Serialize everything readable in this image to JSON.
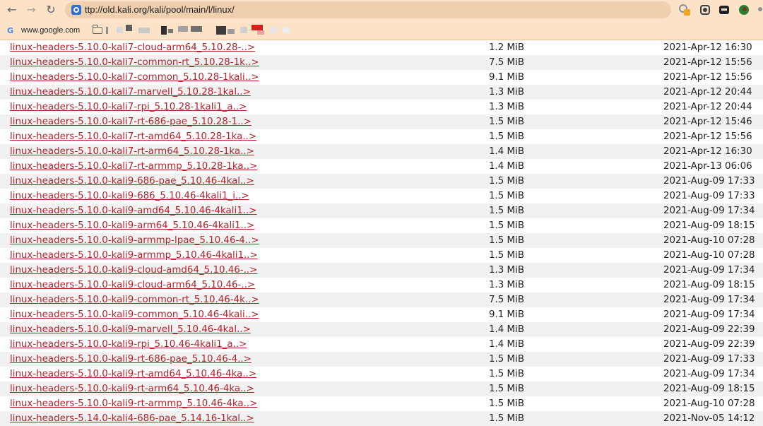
{
  "browser": {
    "back_icon": "back-arrow-icon",
    "forward_icon": "forward-arrow-icon",
    "reload_icon": "reload-icon",
    "url": "ttp://old.kali.org/kali/pool/main/l/linux/",
    "toolbar_color": "#fce3c8",
    "bookmarks": [
      {
        "label": "www.google.com",
        "icon": "google-icon"
      }
    ]
  },
  "listing": {
    "link_color": "#b0242a",
    "alt_row_color": "#f1f1f1",
    "rows": [
      {
        "name": "linux-headers-5.10.0-kali7-cloud-arm64_5.10.28-..>",
        "size": "1.2 MiB",
        "date": "2021-Apr-12 16:30"
      },
      {
        "name": "linux-headers-5.10.0-kali7-common-rt_5.10.28-1k..>",
        "size": "7.5 MiB",
        "date": "2021-Apr-12 15:56"
      },
      {
        "name": "linux-headers-5.10.0-kali7-common_5.10.28-1kali..>",
        "size": "9.1 MiB",
        "date": "2021-Apr-12 15:56"
      },
      {
        "name": "linux-headers-5.10.0-kali7-marvell_5.10.28-1kal..>",
        "size": "1.3 MiB",
        "date": "2021-Apr-12 20:44"
      },
      {
        "name": "linux-headers-5.10.0-kali7-rpi_5.10.28-1kali1_a..>",
        "size": "1.3 MiB",
        "date": "2021-Apr-12 20:44"
      },
      {
        "name": "linux-headers-5.10.0-kali7-rt-686-pae_5.10.28-1..>",
        "size": "1.5 MiB",
        "date": "2021-Apr-12 15:46"
      },
      {
        "name": "linux-headers-5.10.0-kali7-rt-amd64_5.10.28-1ka..>",
        "size": "1.5 MiB",
        "date": "2021-Apr-12 15:56"
      },
      {
        "name": "linux-headers-5.10.0-kali7-rt-arm64_5.10.28-1ka..>",
        "size": "1.4 MiB",
        "date": "2021-Apr-12 16:30"
      },
      {
        "name": "linux-headers-5.10.0-kali7-rt-armmp_5.10.28-1ka..>",
        "size": "1.4 MiB",
        "date": "2021-Apr-13 06:06"
      },
      {
        "name": "linux-headers-5.10.0-kali9-686-pae_5.10.46-4kal..>",
        "size": "1.5 MiB",
        "date": "2021-Aug-09 17:33"
      },
      {
        "name": "linux-headers-5.10.0-kali9-686_5.10.46-4kali1_i..>",
        "size": "1.5 MiB",
        "date": "2021-Aug-09 17:33"
      },
      {
        "name": "linux-headers-5.10.0-kali9-amd64_5.10.46-4kali1..>",
        "size": "1.5 MiB",
        "date": "2021-Aug-09 17:34"
      },
      {
        "name": "linux-headers-5.10.0-kali9-arm64_5.10.46-4kali1..>",
        "size": "1.5 MiB",
        "date": "2021-Aug-09 18:15"
      },
      {
        "name": "linux-headers-5.10.0-kali9-armmp-lpae_5.10.46-4..>",
        "size": "1.5 MiB",
        "date": "2021-Aug-10 07:28"
      },
      {
        "name": "linux-headers-5.10.0-kali9-armmp_5.10.46-4kali1..>",
        "size": "1.5 MiB",
        "date": "2021-Aug-10 07:28"
      },
      {
        "name": "linux-headers-5.10.0-kali9-cloud-amd64_5.10.46-..>",
        "size": "1.3 MiB",
        "date": "2021-Aug-09 17:34"
      },
      {
        "name": "linux-headers-5.10.0-kali9-cloud-arm64_5.10.46-..>",
        "size": "1.3 MiB",
        "date": "2021-Aug-09 18:15"
      },
      {
        "name": "linux-headers-5.10.0-kali9-common-rt_5.10.46-4k..>",
        "size": "7.5 MiB",
        "date": "2021-Aug-09 17:34"
      },
      {
        "name": "linux-headers-5.10.0-kali9-common_5.10.46-4kali..>",
        "size": "9.1 MiB",
        "date": "2021-Aug-09 17:34"
      },
      {
        "name": "linux-headers-5.10.0-kali9-marvell_5.10.46-4kal..>",
        "size": "1.4 MiB",
        "date": "2021-Aug-09 22:39"
      },
      {
        "name": "linux-headers-5.10.0-kali9-rpi_5.10.46-4kali1_a..>",
        "size": "1.4 MiB",
        "date": "2021-Aug-09 22:39"
      },
      {
        "name": "linux-headers-5.10.0-kali9-rt-686-pae_5.10.46-4..>",
        "size": "1.5 MiB",
        "date": "2021-Aug-09 17:33"
      },
      {
        "name": "linux-headers-5.10.0-kali9-rt-amd64_5.10.46-4ka..>",
        "size": "1.5 MiB",
        "date": "2021-Aug-09 17:34"
      },
      {
        "name": "linux-headers-5.10.0-kali9-rt-arm64_5.10.46-4ka..>",
        "size": "1.5 MiB",
        "date": "2021-Aug-09 18:15"
      },
      {
        "name": "linux-headers-5.10.0-kali9-rt-armmp_5.10.46-4ka..>",
        "size": "1.5 MiB",
        "date": "2021-Aug-10 07:28"
      },
      {
        "name": "linux-headers-5.14.0-kali4-686-pae_5.14.16-1kal..>",
        "size": "1.5 MiB",
        "date": "2021-Nov-05 14:12"
      }
    ]
  }
}
